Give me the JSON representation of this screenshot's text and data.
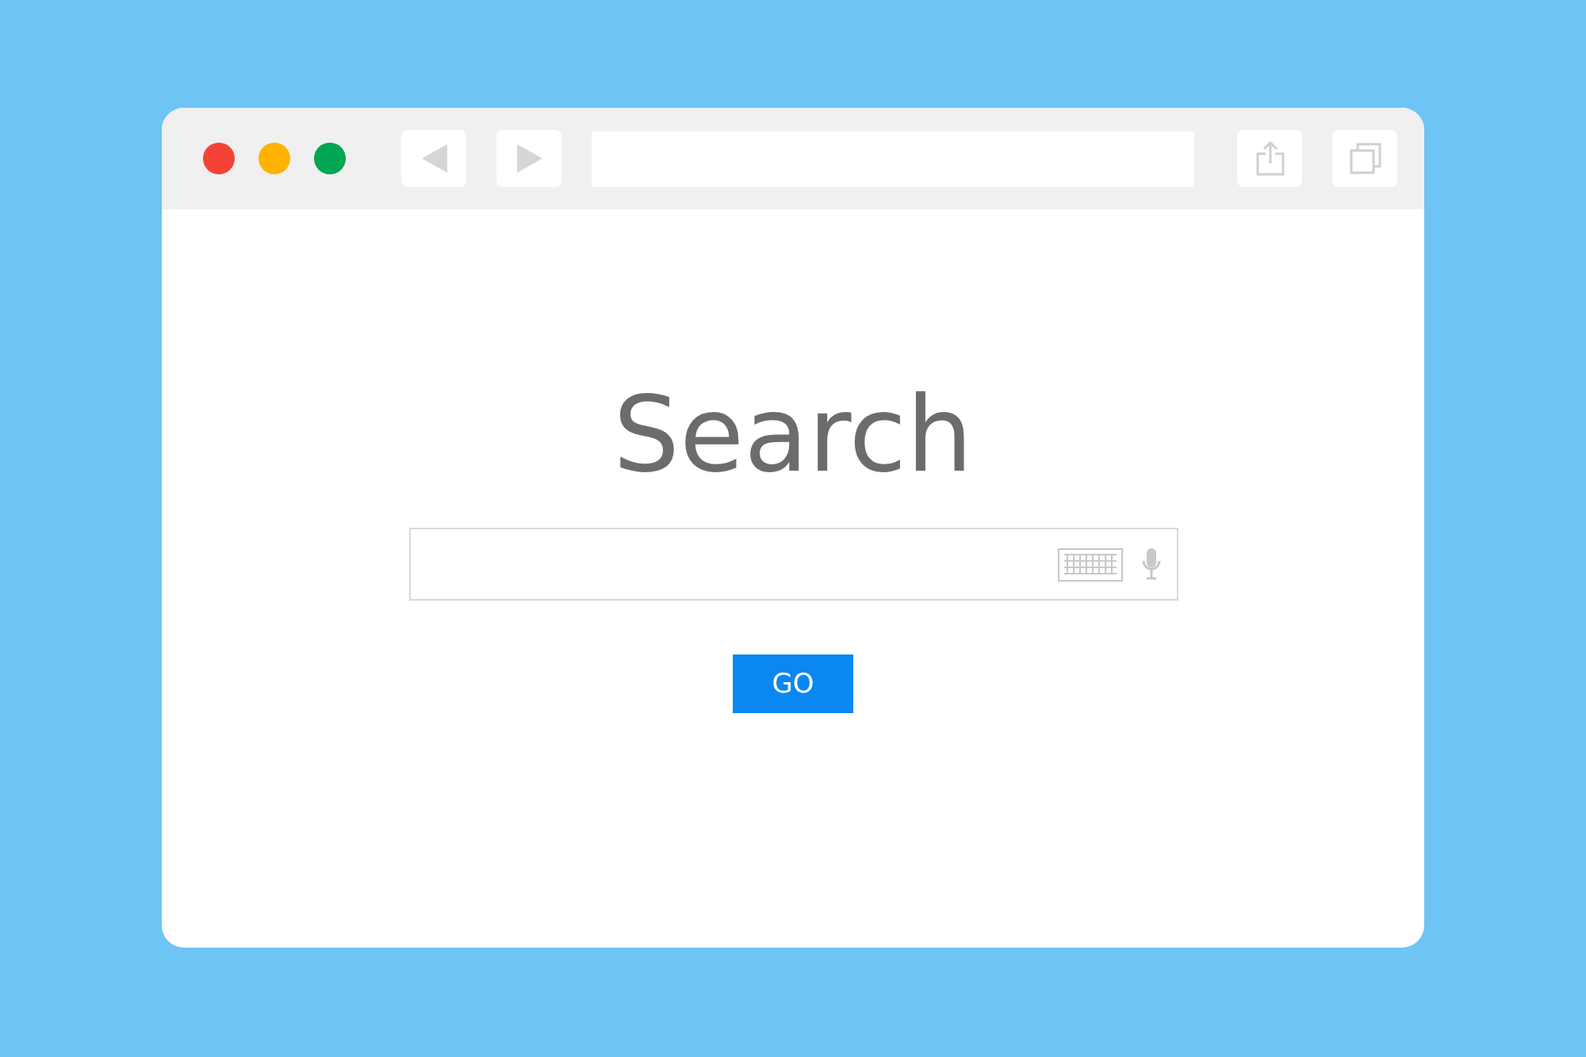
{
  "window": {
    "controls": [
      {
        "color": "#f44336"
      },
      {
        "color": "#ffb300"
      },
      {
        "color": "#00a651"
      }
    ]
  },
  "heading": "Search",
  "button": "GO"
}
